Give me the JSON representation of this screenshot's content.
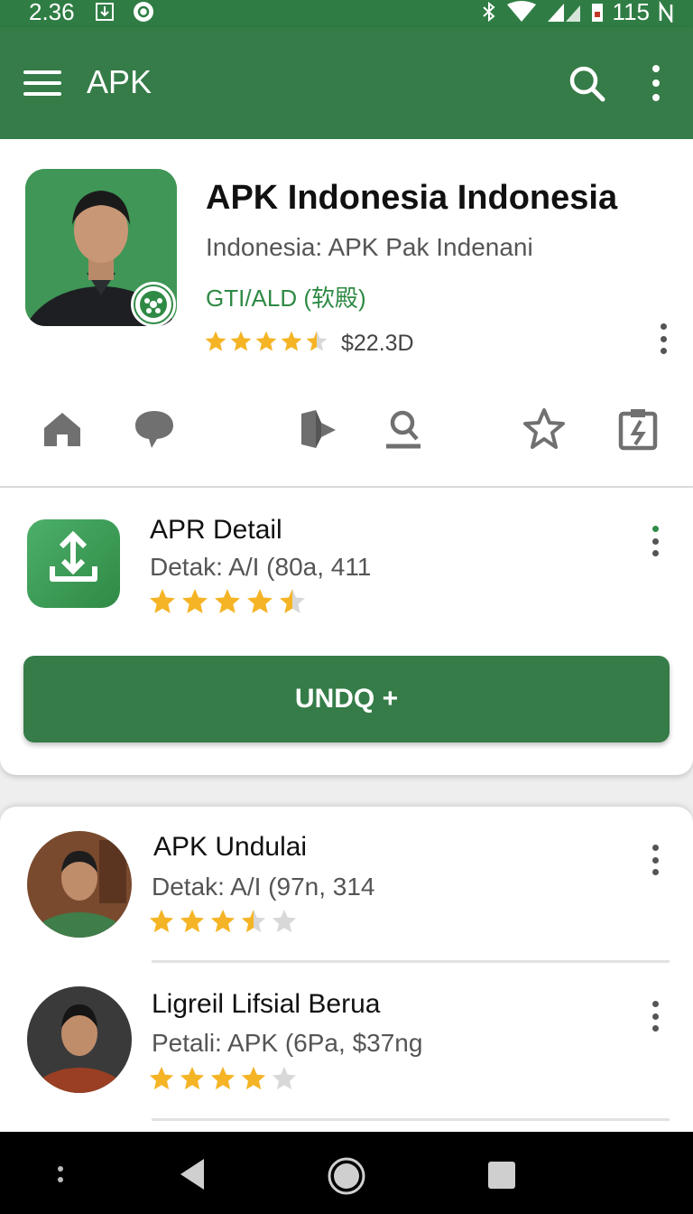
{
  "status_bar": {
    "time": "2.36",
    "right_text": "115",
    "icons": [
      "download-icon",
      "sync-icon",
      "bluetooth-icon",
      "wifi-icon",
      "signal-icon",
      "battery-icon"
    ]
  },
  "app_bar": {
    "title": "APK",
    "icons": [
      "menu-icon",
      "search-icon",
      "more-vert-icon"
    ]
  },
  "hero": {
    "title": "APK Indonesia Indonesia",
    "subtitle": "Indonesia: APK Pak Indenani",
    "meta": "GTI/ALD (软殿)",
    "rating_stars": 4.5,
    "price": "$22.3D"
  },
  "action_icons": [
    "home-icon",
    "comment-icon",
    "bookmark-icon",
    "profile-icon",
    "star-icon",
    "clipboard-icon"
  ],
  "detail": {
    "title": "APR Detail",
    "subtitle": "Detak: A/I (80a, 411",
    "rating_stars": 4.5,
    "install_button": "UNDQ +"
  },
  "list": [
    {
      "title": "APK Undulai",
      "subtitle": "Detak: A/I (97n, 314",
      "rating_stars": 3.5
    },
    {
      "title": "Ligreil Lifsial Berua",
      "subtitle": "Petali: APK (6Pa, $37ng",
      "rating_stars": 4
    }
  ],
  "nav_bar": {
    "icons": [
      "menu-dots-icon",
      "back-icon",
      "home-circle-icon",
      "recents-icon"
    ]
  },
  "colors": {
    "primary": "#357c48",
    "status": "#2f7d44",
    "star": "#f5b425",
    "star_empty": "#d8d8d8",
    "accent_text": "#2f8a45"
  }
}
